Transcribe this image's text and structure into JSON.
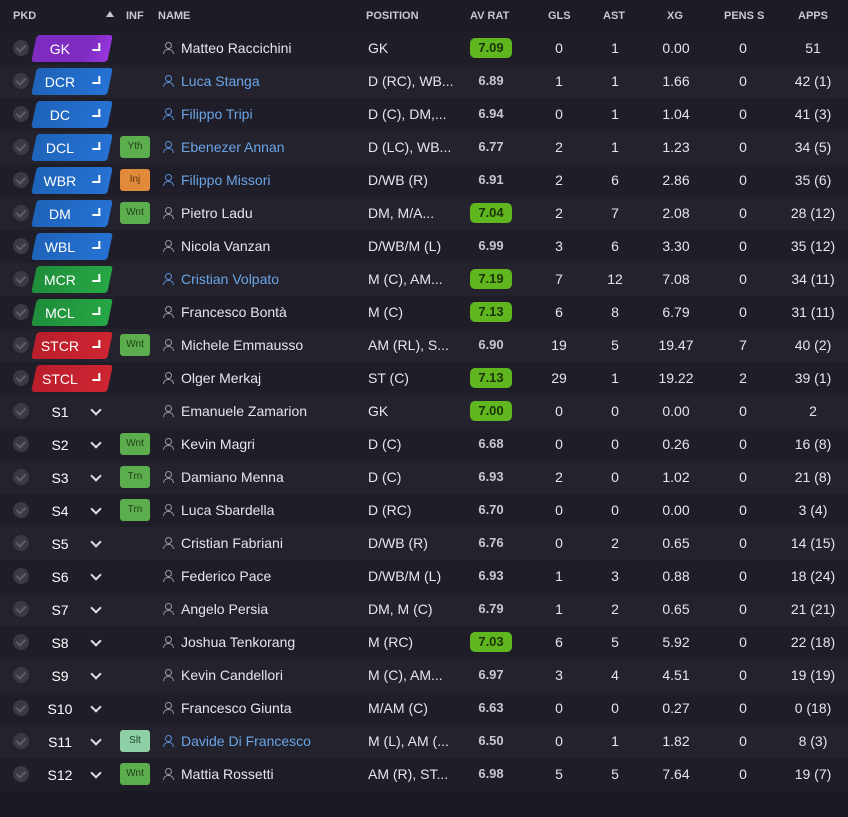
{
  "columns": {
    "pkd": "PKD",
    "inf": "INF",
    "name": "NAME",
    "position": "POSITION",
    "av_rat": "AV RAT",
    "gls": "GLS",
    "ast": "AST",
    "xg": "XG",
    "pens": "PENS S",
    "apps": "APPS"
  },
  "rows": [
    {
      "slot": "GK",
      "role": "gk",
      "inf": "",
      "name": "Matteo Raccichini",
      "link": false,
      "position": "GK",
      "av_rat": "7.09",
      "hi": true,
      "gls": "0",
      "ast": "1",
      "xg": "0.00",
      "pens": "0",
      "apps": "51"
    },
    {
      "slot": "DCR",
      "role": "def",
      "inf": "",
      "name": "Luca Stanga",
      "link": true,
      "position": "D (RC), WB...",
      "av_rat": "6.89",
      "hi": false,
      "gls": "1",
      "ast": "1",
      "xg": "1.66",
      "pens": "0",
      "apps": "42 (1)"
    },
    {
      "slot": "DC",
      "role": "def",
      "inf": "",
      "name": "Filippo Tripi",
      "link": true,
      "position": "D (C), DM,...",
      "av_rat": "6.94",
      "hi": false,
      "gls": "0",
      "ast": "1",
      "xg": "1.04",
      "pens": "0",
      "apps": "41 (3)"
    },
    {
      "slot": "DCL",
      "role": "def",
      "inf": "Yth",
      "inf_style": "grn",
      "name": "Ebenezer Annan",
      "link": true,
      "position": "D (LC), WB...",
      "av_rat": "6.77",
      "hi": false,
      "gls": "2",
      "ast": "1",
      "xg": "1.23",
      "pens": "0",
      "apps": "34 (5)"
    },
    {
      "slot": "WBR",
      "role": "def",
      "inf": "Inj",
      "inf_style": "org",
      "name": "Filippo Missori",
      "link": true,
      "position": "D/WB (R)",
      "av_rat": "6.91",
      "hi": false,
      "gls": "2",
      "ast": "6",
      "xg": "2.86",
      "pens": "0",
      "apps": "35 (6)"
    },
    {
      "slot": "DM",
      "role": "def",
      "inf": "Wnt",
      "inf_style": "grn",
      "name": "Pietro Ladu",
      "link": false,
      "position": "DM, M/A...",
      "av_rat": "7.04",
      "hi": true,
      "gls": "2",
      "ast": "7",
      "xg": "2.08",
      "pens": "0",
      "apps": "28 (12)"
    },
    {
      "slot": "WBL",
      "role": "def",
      "inf": "",
      "name": "Nicola Vanzan",
      "link": false,
      "position": "D/WB/M (L)",
      "av_rat": "6.99",
      "hi": false,
      "gls": "3",
      "ast": "6",
      "xg": "3.30",
      "pens": "0",
      "apps": "35 (12)"
    },
    {
      "slot": "MCR",
      "role": "mid",
      "inf": "",
      "name": "Cristian Volpato",
      "link": true,
      "position": "M (C), AM...",
      "av_rat": "7.19",
      "hi": true,
      "gls": "7",
      "ast": "12",
      "xg": "7.08",
      "pens": "0",
      "apps": "34 (11)"
    },
    {
      "slot": "MCL",
      "role": "mid",
      "inf": "",
      "name": "Francesco Bontà",
      "link": false,
      "position": "M (C)",
      "av_rat": "7.13",
      "hi": true,
      "gls": "6",
      "ast": "8",
      "xg": "6.79",
      "pens": "0",
      "apps": "31 (11)"
    },
    {
      "slot": "STCR",
      "role": "att",
      "inf": "Wnt",
      "inf_style": "grn",
      "name": "Michele Emmausso",
      "link": false,
      "position": "AM (RL), S...",
      "av_rat": "6.90",
      "hi": false,
      "gls": "19",
      "ast": "5",
      "xg": "19.47",
      "pens": "7",
      "apps": "40 (2)"
    },
    {
      "slot": "STCL",
      "role": "att",
      "inf": "",
      "name": "Olger Merkaj",
      "link": false,
      "position": "ST (C)",
      "av_rat": "7.13",
      "hi": true,
      "gls": "29",
      "ast": "1",
      "xg": "19.22",
      "pens": "2",
      "apps": "39 (1)"
    },
    {
      "slot": "S1",
      "role": "sub",
      "inf": "",
      "name": "Emanuele Zamarion",
      "link": false,
      "position": "GK",
      "av_rat": "7.00",
      "hi": true,
      "gls": "0",
      "ast": "0",
      "xg": "0.00",
      "pens": "0",
      "apps": "2"
    },
    {
      "slot": "S2",
      "role": "sub",
      "inf": "Wnt",
      "inf_style": "grn",
      "name": "Kevin Magri",
      "link": false,
      "position": "D (C)",
      "av_rat": "6.68",
      "hi": false,
      "gls": "0",
      "ast": "0",
      "xg": "0.26",
      "pens": "0",
      "apps": "16 (8)"
    },
    {
      "slot": "S3",
      "role": "sub",
      "inf": "Trn",
      "inf_style": "grn",
      "name": "Damiano Menna",
      "link": false,
      "position": "D (C)",
      "av_rat": "6.93",
      "hi": false,
      "gls": "2",
      "ast": "0",
      "xg": "1.02",
      "pens": "0",
      "apps": "21 (8)"
    },
    {
      "slot": "S4",
      "role": "sub",
      "inf": "Trn",
      "inf_style": "grn",
      "name": "Luca Sbardella",
      "link": false,
      "position": "D (RC)",
      "av_rat": "6.70",
      "hi": false,
      "gls": "0",
      "ast": "0",
      "xg": "0.00",
      "pens": "0",
      "apps": "3 (4)"
    },
    {
      "slot": "S5",
      "role": "sub",
      "inf": "",
      "name": "Cristian Fabriani",
      "link": false,
      "position": "D/WB (R)",
      "av_rat": "6.76",
      "hi": false,
      "gls": "0",
      "ast": "2",
      "xg": "0.65",
      "pens": "0",
      "apps": "14 (15)"
    },
    {
      "slot": "S6",
      "role": "sub",
      "inf": "",
      "name": "Federico Pace",
      "link": false,
      "position": "D/WB/M (L)",
      "av_rat": "6.93",
      "hi": false,
      "gls": "1",
      "ast": "3",
      "xg": "0.88",
      "pens": "0",
      "apps": "18 (24)"
    },
    {
      "slot": "S7",
      "role": "sub",
      "inf": "",
      "name": "Angelo Persia",
      "link": false,
      "position": "DM, M (C)",
      "av_rat": "6.79",
      "hi": false,
      "gls": "1",
      "ast": "2",
      "xg": "0.65",
      "pens": "0",
      "apps": "21 (21)"
    },
    {
      "slot": "S8",
      "role": "sub",
      "inf": "",
      "name": "Joshua Tenkorang",
      "link": false,
      "position": "M (RC)",
      "av_rat": "7.03",
      "hi": true,
      "gls": "6",
      "ast": "5",
      "xg": "5.92",
      "pens": "0",
      "apps": "22 (18)"
    },
    {
      "slot": "S9",
      "role": "sub",
      "inf": "",
      "name": "Kevin Candellori",
      "link": false,
      "position": "M (C), AM...",
      "av_rat": "6.97",
      "hi": false,
      "gls": "3",
      "ast": "4",
      "xg": "4.51",
      "pens": "0",
      "apps": "19 (19)"
    },
    {
      "slot": "S10",
      "role": "sub",
      "inf": "",
      "name": "Francesco Giunta",
      "link": false,
      "position": "M/AM (C)",
      "av_rat": "6.63",
      "hi": false,
      "gls": "0",
      "ast": "0",
      "xg": "0.27",
      "pens": "0",
      "apps": "0 (18)"
    },
    {
      "slot": "S11",
      "role": "sub",
      "inf": "Slt",
      "inf_style": "pale",
      "name": "Davide Di Francesco",
      "link": true,
      "position": "M (L), AM (...",
      "av_rat": "6.50",
      "hi": false,
      "gls": "0",
      "ast": "1",
      "xg": "1.82",
      "pens": "0",
      "apps": "8 (3)"
    },
    {
      "slot": "S12",
      "role": "sub",
      "inf": "Wnt",
      "inf_style": "grn",
      "name": "Mattia Rossetti",
      "link": false,
      "position": "AM (R), ST...",
      "av_rat": "6.98",
      "hi": false,
      "gls": "5",
      "ast": "5",
      "xg": "7.64",
      "pens": "0",
      "apps": "19 (7)"
    }
  ]
}
